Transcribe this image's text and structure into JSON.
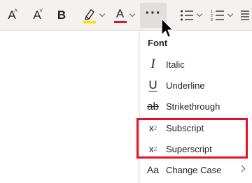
{
  "toolbar": {
    "grow_font_glyph": "A",
    "shrink_font_glyph": "A",
    "bold_glyph": "B",
    "font_color_glyph": "A",
    "more_glyph": "···",
    "highlight_color": "#fce100",
    "font_color": "#e81123"
  },
  "menu": {
    "header": "Font",
    "items": [
      {
        "label": "Italic",
        "icon": "italic-icon",
        "glyph": "I"
      },
      {
        "label": "Underline",
        "icon": "underline-icon",
        "glyph": "U"
      },
      {
        "label": "Strikethrough",
        "icon": "strikethrough-icon",
        "glyph": "ab"
      },
      {
        "label": "Subscript",
        "icon": "subscript-icon",
        "glyph": "x",
        "sub": "2"
      },
      {
        "label": "Superscript",
        "icon": "superscript-icon",
        "glyph": "x",
        "sup": "2"
      },
      {
        "label": "Change Case",
        "icon": "change-case-icon",
        "glyph": "Aa"
      }
    ]
  },
  "highlight_box_color": "#e81123"
}
